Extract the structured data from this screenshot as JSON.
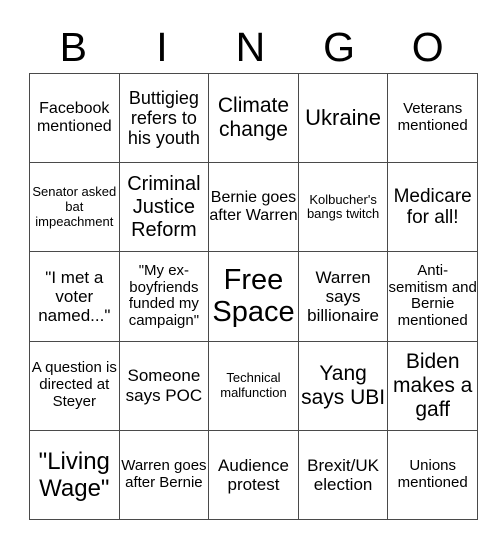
{
  "header": [
    "B",
    "I",
    "N",
    "G",
    "O"
  ],
  "grid": [
    [
      "Facebook mentioned",
      "Buttigieg refers to his youth",
      "Climate change",
      "Ukraine",
      "Veterans mentioned"
    ],
    [
      "Senator asked bat impeachment",
      "Criminal Justice Reform",
      "Bernie goes after Warren",
      "Kolbucher's bangs twitch",
      "Medicare for all!"
    ],
    [
      "\"I met a voter named...\"",
      "\"My ex-boyfriends funded my campaign\"",
      "Free Space",
      "Warren says billionaire",
      "Anti-semitism and Bernie mentioned"
    ],
    [
      "A question is directed at Steyer",
      "Someone says POC",
      "Technical malfunction",
      "Yang says UBI",
      "Biden makes a gaff"
    ],
    [
      "\"Living Wage\"",
      "Warren goes after Bernie",
      "Audience protest",
      "Brexit/UK election",
      "Unions mentioned"
    ]
  ]
}
